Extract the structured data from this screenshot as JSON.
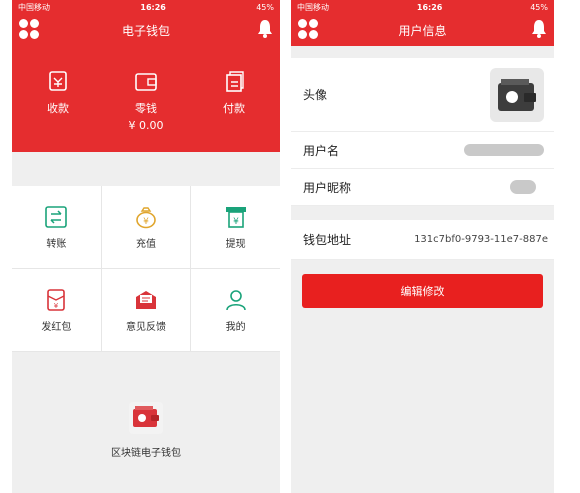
{
  "status": {
    "carrier": "中国移动",
    "time": "16:26",
    "battery": "45%"
  },
  "left": {
    "title": "电子钱包",
    "hero": {
      "receive": "收款",
      "balance": "零钱",
      "balance_value": "¥ 0.00",
      "pay": "付款"
    },
    "grid": {
      "transfer": "转账",
      "recharge": "充值",
      "withdraw": "提现",
      "red_packet": "发红包",
      "feedback": "意见反馈",
      "mine": "我的"
    },
    "blockchain_label": "区块链电子钱包"
  },
  "right": {
    "title": "用户信息",
    "avatar_label": "头像",
    "username_label": "用户名",
    "nickname_label": "用户昵称",
    "wallet_label": "钱包地址",
    "wallet_address": "131c7bf0-9793-11e7-887e",
    "edit_button": "编辑修改"
  },
  "colors": {
    "brand_red": "#e52d2f",
    "icon_green": "#1aa37a",
    "icon_gold": "#e0a52c",
    "icon_red": "#d9343a"
  }
}
